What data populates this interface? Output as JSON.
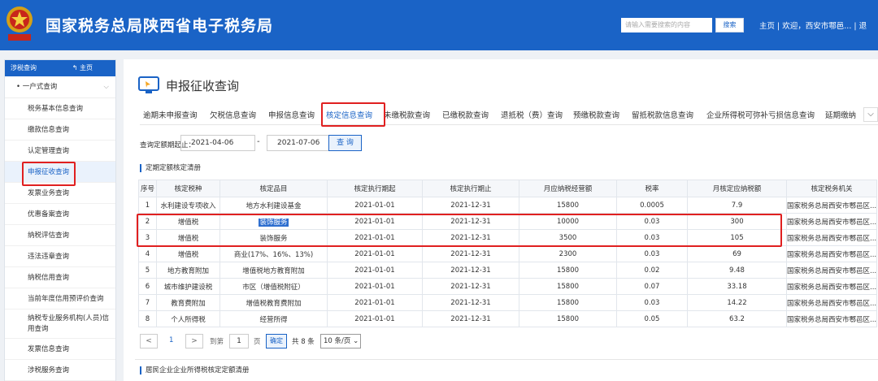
{
  "header": {
    "logo_text": "国家税务",
    "title": "国家税务总局陕西省电子税务局",
    "search_placeholder": "请输入需要搜索的内容",
    "search_button": "搜索",
    "home_link": "主页",
    "welcome": "欢迎，西安市鄠邑...",
    "exit_link": "退"
  },
  "sidebar": {
    "section": "涉税查询",
    "home": "主页",
    "group": "一户式查询",
    "items": [
      "税务基本信息查询",
      "缴款信息查询",
      "认定管理查询",
      "申报征收查询",
      "发票业务查询",
      "优惠备案查询",
      "纳税评估查询",
      "违法违章查询",
      "纳税信用查询",
      "当前年度信用预评价查询",
      "纳税专业服务机构(人员)信用查询",
      "发票信息查询",
      "涉税服务查询"
    ]
  },
  "main": {
    "title": "申报征收查询",
    "tabs": [
      "逾期未申报查询",
      "欠税信息查询",
      "申报信息查询",
      "核定信息查询",
      "未缴税款查询",
      "已缴税款查询",
      "退抵税（费）查询",
      "预缴税款查询",
      "留抵税款信息查询",
      "企业所得税可弥补亏损信息查询",
      "延期缴纳"
    ],
    "query_label": "查询定额期起止：",
    "date_from": "2021-04-06",
    "date_to": "2021-07-06",
    "date_sep": "-",
    "query_button": "查 询",
    "section1": "定期定额核定清册",
    "section2": "居民企业企业所得税核定定额清册"
  },
  "table": {
    "headers": [
      "序号",
      "核定税种",
      "核定品目",
      "核定执行期起",
      "核定执行期止",
      "月应纳税经营额",
      "税率",
      "月核定应纳税额",
      "核定税务机关"
    ],
    "rows": [
      [
        "1",
        "水利建设专项收入",
        "地方水利建设基金",
        "2021-01-01",
        "2021-12-31",
        "15800",
        "0.0005",
        "7.9",
        "国家税务总局西安市鄠邑区..."
      ],
      [
        "2",
        "增值税",
        "装饰服务",
        "2021-01-01",
        "2021-12-31",
        "10000",
        "0.03",
        "300",
        "国家税务总局西安市鄠邑区..."
      ],
      [
        "3",
        "增值税",
        "装饰服务",
        "2021-01-01",
        "2021-12-31",
        "3500",
        "0.03",
        "105",
        "国家税务总局西安市鄠邑区..."
      ],
      [
        "4",
        "增值税",
        "商业(17%、16%、13%)",
        "2021-01-01",
        "2021-12-31",
        "2300",
        "0.03",
        "69",
        "国家税务总局西安市鄠邑区..."
      ],
      [
        "5",
        "地方教育附加",
        "增值税地方教育附加",
        "2021-01-01",
        "2021-12-31",
        "15800",
        "0.02",
        "9.48",
        "国家税务总局西安市鄠邑区..."
      ],
      [
        "6",
        "城市维护建设税",
        "市区（增值税附征）",
        "2021-01-01",
        "2021-12-31",
        "15800",
        "0.07",
        "33.18",
        "国家税务总局西安市鄠邑区..."
      ],
      [
        "7",
        "教育费附加",
        "增值税教育费附加",
        "2021-01-01",
        "2021-12-31",
        "15800",
        "0.03",
        "14.22",
        "国家税务总局西安市鄠邑区..."
      ],
      [
        "8",
        "个人所得税",
        "经营所得",
        "2021-01-01",
        "2021-12-31",
        "15800",
        "0.05",
        "63.2",
        "国家税务总局西安市鄠邑区..."
      ]
    ]
  },
  "pager": {
    "prev": "<",
    "current": "1",
    "next": ">",
    "goto_label": "到第",
    "goto_value": "1",
    "page_unit": "页",
    "ok_button": "确定",
    "total": "共 8 条",
    "page_size": "10 条/页"
  },
  "colors": {
    "brand": "#1a63c6",
    "highlight_box": "#e02020"
  }
}
